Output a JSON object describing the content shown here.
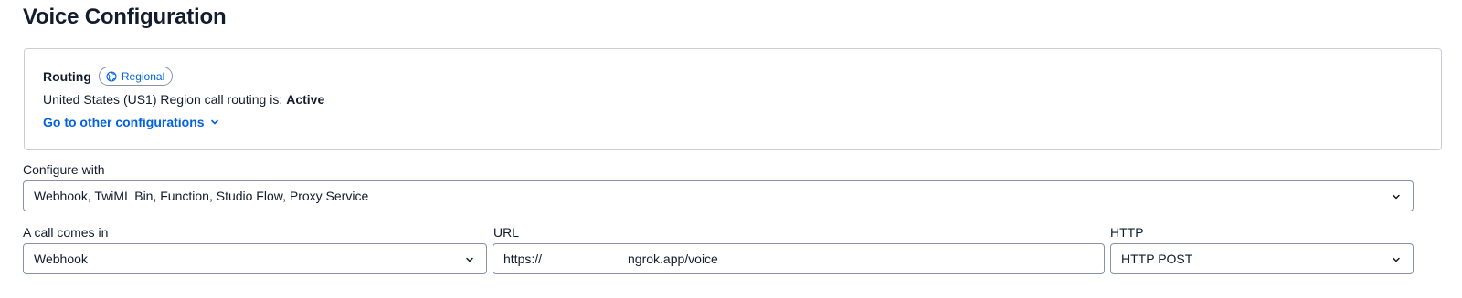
{
  "page": {
    "title": "Voice Configuration"
  },
  "routing": {
    "label": "Routing",
    "badge": {
      "label": "Regional",
      "icon": "globe-icon"
    },
    "status_text": "United States (US1) Region call routing is:",
    "status_value": "Active",
    "link_label": "Go to other configurations",
    "link_icon": "chevron-down-icon"
  },
  "configure_with": {
    "label": "Configure with",
    "value": "Webhook, TwiML Bin, Function, Studio Flow, Proxy Service"
  },
  "call_comes_in": {
    "label": "A call comes in",
    "value": "Webhook"
  },
  "url": {
    "label": "URL",
    "prefix": "https://",
    "suffix": "ngrok.app/voice"
  },
  "http": {
    "label": "HTTP",
    "value": "HTTP POST"
  },
  "colors": {
    "text": "#121c2d",
    "link": "#0263e0",
    "border": "#8891aa",
    "card_border": "#cacdd8"
  }
}
